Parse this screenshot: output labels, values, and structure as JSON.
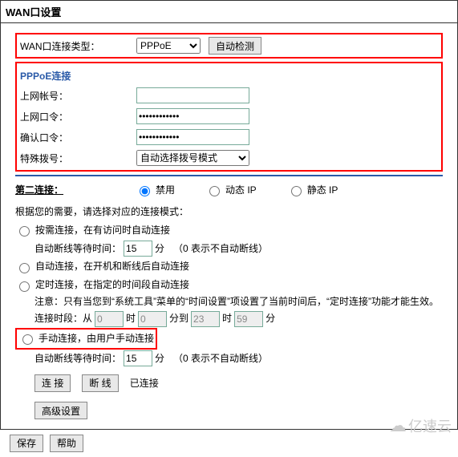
{
  "window": {
    "title": "WAN口设置"
  },
  "wan": {
    "type_label": "WAN口连接类型：",
    "type_value": "PPPoE",
    "detect_btn": "自动检测"
  },
  "pppoe": {
    "legend": "PPPoE连接",
    "user_label": "上网帐号：",
    "user_value": "",
    "pass_label": "上网口令：",
    "pass_value": "••••••••••••",
    "confirm_label": "确认口令：",
    "confirm_value": "••••••••••••",
    "dial_label": "特殊拨号：",
    "dial_value": "自动选择拨号模式"
  },
  "second": {
    "label": "第二连接：",
    "opt_disable": "禁用",
    "opt_dynip": "动态 IP",
    "opt_staticip": "静态 IP"
  },
  "modes": {
    "intro": "根据您的需要，请选择对应的连接模式：",
    "on_demand": "按需连接，在有访问时自动连接",
    "idle_label": "自动断线等待时间：",
    "idle_value": "15",
    "idle_unit": "分",
    "idle_hint": "（0 表示不自动断线）",
    "auto": "自动连接，在开机和断线后自动连接",
    "scheduled": "定时连接，在指定的时间段自动连接",
    "sched_note": "注意：只有当您到“系统工具”菜单的“时间设置”项设置了当前时间后，“定时连接”功能才能生效。",
    "sched_prefix": "连接时段：从",
    "h1": "0",
    "m1": "0",
    "to": "分到",
    "h2": "23",
    "m2": "59",
    "hour": "时",
    "min": "分",
    "manual": "手动连接，由用户手动连接",
    "manual_idle_value": "15"
  },
  "actions": {
    "connect": "连 接",
    "disconnect": "断 线",
    "status": "已连接",
    "advanced": "高级设置"
  },
  "footer": {
    "save": "保存",
    "help": "帮助"
  },
  "watermark": "亿速云"
}
